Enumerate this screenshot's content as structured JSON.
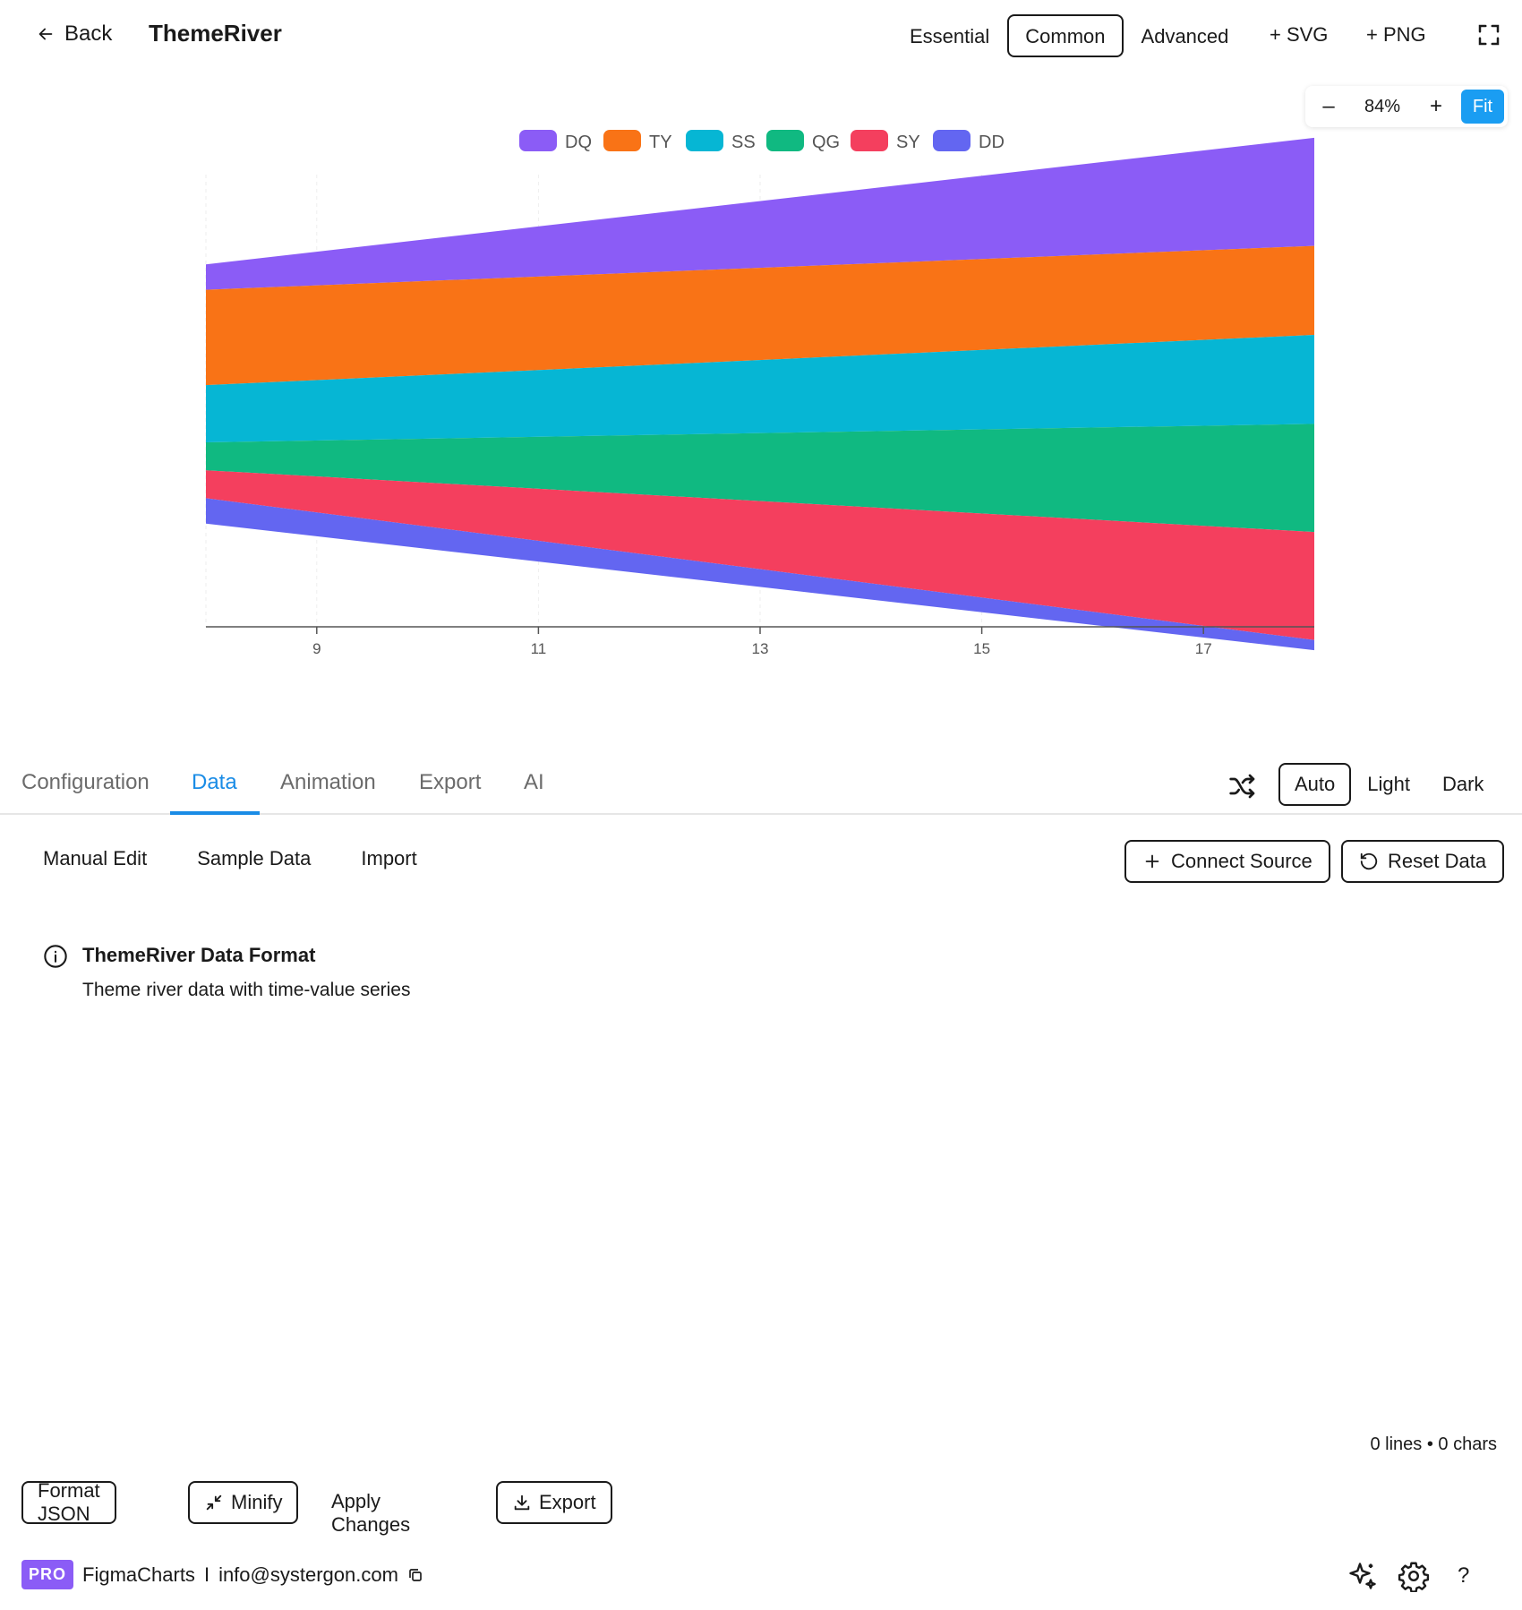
{
  "header": {
    "back_label": "Back",
    "title": "ThemeRiver",
    "tiers": [
      "Essential",
      "Common",
      "Advanced"
    ],
    "active_tier": "Common",
    "add_svg": "+ SVG",
    "add_png": "+ PNG"
  },
  "zoom": {
    "minus": "–",
    "value": "84%",
    "plus": "+",
    "fit": "Fit"
  },
  "chart_data": {
    "type": "area",
    "subtype": "themeriver",
    "x": [
      8,
      18
    ],
    "x_ticks": [
      9,
      11,
      13,
      15,
      17
    ],
    "x_range": [
      8,
      18
    ],
    "series": [
      {
        "name": "DQ",
        "color": "#8b5cf6",
        "values": [
          20,
          85
        ]
      },
      {
        "name": "TY",
        "color": "#f97316",
        "values": [
          75,
          70
        ]
      },
      {
        "name": "SS",
        "color": "#06b6d4",
        "values": [
          45,
          70
        ]
      },
      {
        "name": "QG",
        "color": "#10b981",
        "values": [
          22,
          85
        ]
      },
      {
        "name": "SY",
        "color": "#f43f5e",
        "values": [
          22,
          85
        ]
      },
      {
        "name": "DD",
        "color": "#6366f1",
        "values": [
          20,
          8
        ]
      }
    ],
    "legend_position": "top-center",
    "grid": "vertical-dashed"
  },
  "tabs": [
    "Configuration",
    "Data",
    "Animation",
    "Export",
    "AI"
  ],
  "active_tab": "Data",
  "themes": [
    "Auto",
    "Light",
    "Dark"
  ],
  "active_theme": "Auto",
  "subtabs": [
    "Manual Edit",
    "Sample Data",
    "Import"
  ],
  "actions": {
    "connect": "Connect Source",
    "reset": "Reset Data"
  },
  "info": {
    "title": "ThemeRiver Data Format",
    "description": "Theme river data with time-value series"
  },
  "editor_stats": "0 lines • 0 chars",
  "bottom": {
    "format": "Format JSON",
    "minify": "Minify",
    "apply": "Apply Changes",
    "export": "Export"
  },
  "footer": {
    "badge": "PRO",
    "brand": "FigmaCharts",
    "separator": "I",
    "email": "info@systergon.com",
    "help": "?"
  },
  "icons": {
    "back": "arrow-left-icon",
    "fullscreen": "expand-icon",
    "shuffle": "shuffle-icon",
    "info": "info-circle-icon",
    "connect": "plus-icon",
    "reset": "rotate-ccw-icon",
    "minify": "minimize-arrows-icon",
    "export": "download-icon",
    "copy": "copy-icon",
    "ai": "sparkles-icon",
    "settings": "gear-icon"
  }
}
